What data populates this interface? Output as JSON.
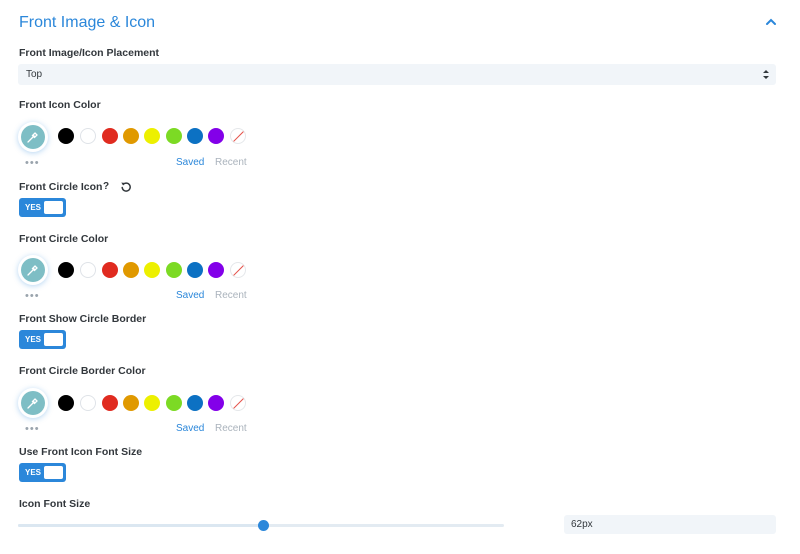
{
  "section": {
    "title": "Front Image & Icon"
  },
  "placement": {
    "label": "Front Image/Icon Placement",
    "value": "Top"
  },
  "swatch_colors": [
    "#000000",
    "#ffffff",
    "#e02b20",
    "#e09900",
    "#edf000",
    "#7cda24",
    "#0c71c3",
    "#8300e9"
  ],
  "picker_color": "#7ebec5",
  "accent_color": "#2b87da",
  "color_groups": [
    {
      "label": "Front Icon Color",
      "saved_tab": "Saved",
      "recent_tab": "Recent"
    },
    {
      "label": "Front Circle Color",
      "saved_tab": "Saved",
      "recent_tab": "Recent"
    },
    {
      "label": "Front Circle Border Color",
      "saved_tab": "Saved",
      "recent_tab": "Recent"
    }
  ],
  "toggles": [
    {
      "label": "Front Circle Icon",
      "state": "YES",
      "help_icon": "question-mark-icon",
      "reset_icon": "reset-icon"
    },
    {
      "label": "Front Show Circle Border",
      "state": "YES"
    },
    {
      "label": "Use Front Icon Font Size",
      "state": "YES"
    }
  ],
  "icon_font_size": {
    "label": "Icon Font Size",
    "value": "62px",
    "slider_fraction": 0.505
  },
  "help_symbol": "?"
}
